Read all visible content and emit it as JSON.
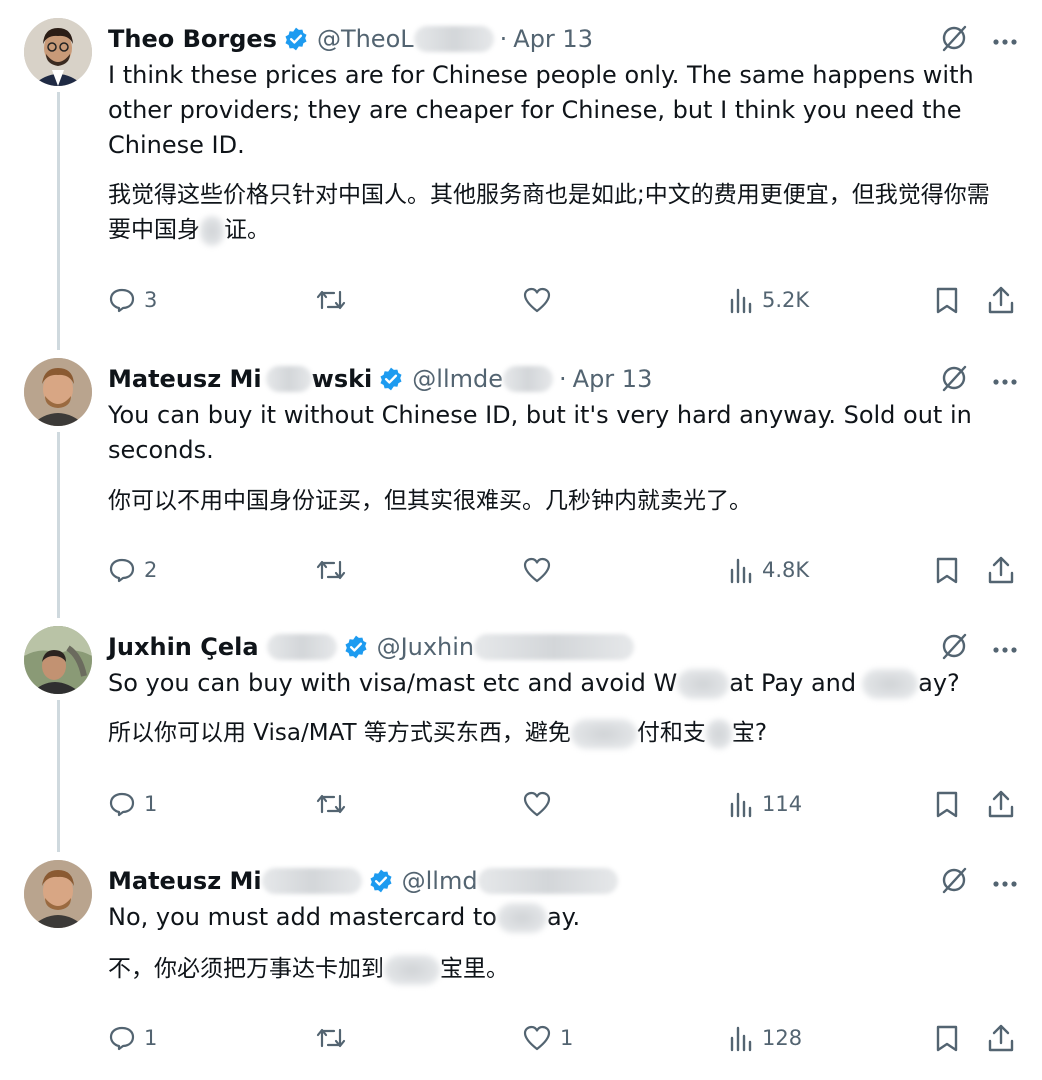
{
  "tweets": [
    {
      "name": "Theo Borges",
      "handle": "@TheoL",
      "dot": "·",
      "date": "Apr 13",
      "text_en": "I think these prices are for Chinese people only. The same happens with other providers; they are cheaper for Chinese, but I think you need the Chinese ID.",
      "text_zh_a": "我觉得这些价格只针对中国人。其他服务商也是如此;中文的费用更便宜，但我觉得你需要中国身",
      "text_zh_b": "证。",
      "replies": "3",
      "reposts": "",
      "likes": "",
      "views": "5.2K"
    },
    {
      "name_a": "Mateusz Mi",
      "name_b": "wski",
      "handle": "@llmde",
      "dot": "·",
      "date": "Apr 13",
      "text_en": "You can buy it without Chinese ID, but it's very hard anyway. Sold out in seconds.",
      "text_zh": "你可以不用中国身份证买，但其实很难买。几秒钟内就卖光了。",
      "replies": "2",
      "reposts": "",
      "likes": "",
      "views": "4.8K"
    },
    {
      "name": "Juxhin Çela",
      "handle": "@Juxhin",
      "text_en_a": "So you can buy with visa/mast etc and avoid W",
      "text_en_b": "at Pay and",
      "text_en_c": "ay?",
      "text_zh_a": "所以你可以用 Visa/MAT 等方式买东西，避免",
      "text_zh_b": "付和支",
      "text_zh_c": "宝?",
      "replies": "1",
      "reposts": "",
      "likes": "",
      "views": "114"
    },
    {
      "name": "Mateusz Mi",
      "handle": "@llmd",
      "text_en_a": "No, you must add mastercard to",
      "text_en_b": "ay.",
      "text_zh_a": "不，你必须把万事达卡加到",
      "text_zh_b": "宝里。",
      "replies": "1",
      "reposts": "",
      "likes": "1",
      "views": "128"
    }
  ],
  "icons": {
    "verified": "verified-badge-icon",
    "grok": "grok-icon",
    "more": "more-icon",
    "reply": "reply-icon",
    "repost": "repost-icon",
    "like": "like-icon",
    "views": "views-icon",
    "bookmark": "bookmark-icon",
    "share": "share-icon"
  },
  "colors": {
    "text": "#0f1419",
    "secondary": "#536471",
    "verified": "#1d9bf0",
    "thread_line": "#cfd9de"
  }
}
